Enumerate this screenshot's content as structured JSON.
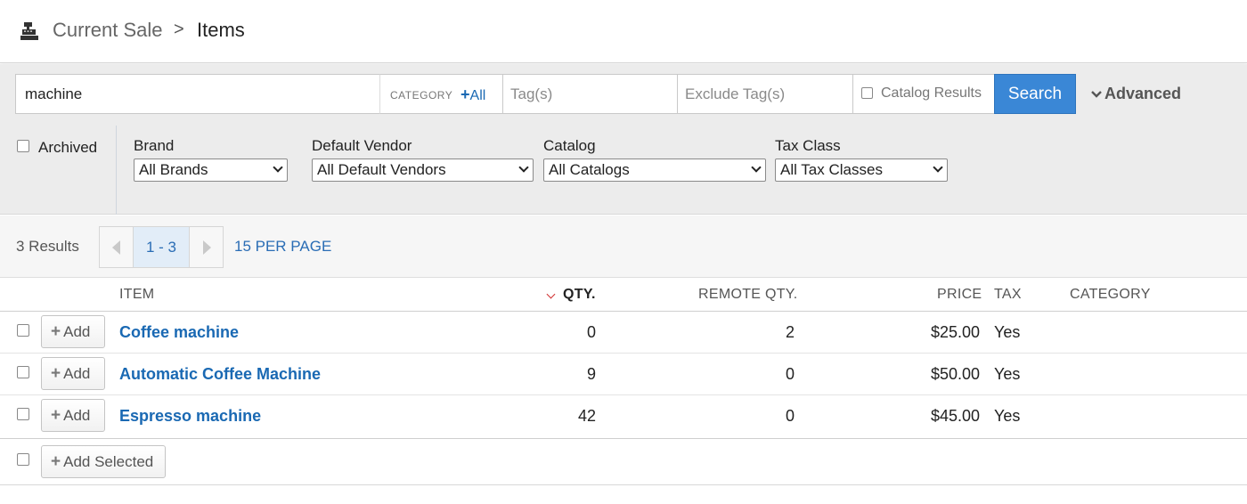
{
  "header": {
    "icon": "cash-register-icon",
    "breadcrumb_parent": "Current Sale",
    "breadcrumb_separator": ">",
    "title": "Items"
  },
  "search": {
    "query": "machine",
    "category_label": "CATEGORY",
    "category_value": "All",
    "tags_placeholder": "Tag(s)",
    "exclude_tags_placeholder": "Exclude Tag(s)",
    "catalog_results_label": "Catalog Results",
    "search_button": "Search",
    "advanced_label": "Advanced"
  },
  "filters": {
    "archived_label": "Archived",
    "brand": {
      "label": "Brand",
      "value": "All Brands"
    },
    "default_vendor": {
      "label": "Default Vendor",
      "value": "All Default Vendors"
    },
    "catalog": {
      "label": "Catalog",
      "value": "All Catalogs"
    },
    "tax_class": {
      "label": "Tax Class",
      "value": "All Tax Classes"
    }
  },
  "results": {
    "count_text": "3 Results",
    "page_range": "1 - 3",
    "per_page": "15 PER PAGE"
  },
  "table": {
    "columns": {
      "item": "ITEM",
      "qty": "QTY.",
      "remote_qty": "REMOTE QTY.",
      "price": "PRICE",
      "tax": "TAX",
      "category": "CATEGORY"
    },
    "add_label": "Add",
    "rows": [
      {
        "item": "Coffee machine",
        "qty": "0",
        "remote_qty": "2",
        "price": "$25.00",
        "tax": "Yes",
        "category": ""
      },
      {
        "item": "Automatic Coffee Machine",
        "qty": "9",
        "remote_qty": "0",
        "price": "$50.00",
        "tax": "Yes",
        "category": ""
      },
      {
        "item": "Espresso machine",
        "qty": "42",
        "remote_qty": "0",
        "price": "$45.00",
        "tax": "Yes",
        "category": ""
      }
    ],
    "add_selected_label": "Add Selected"
  },
  "colors": {
    "accent": "#3a87d6",
    "link": "#1a69b3",
    "sort_indicator": "#d03030"
  }
}
